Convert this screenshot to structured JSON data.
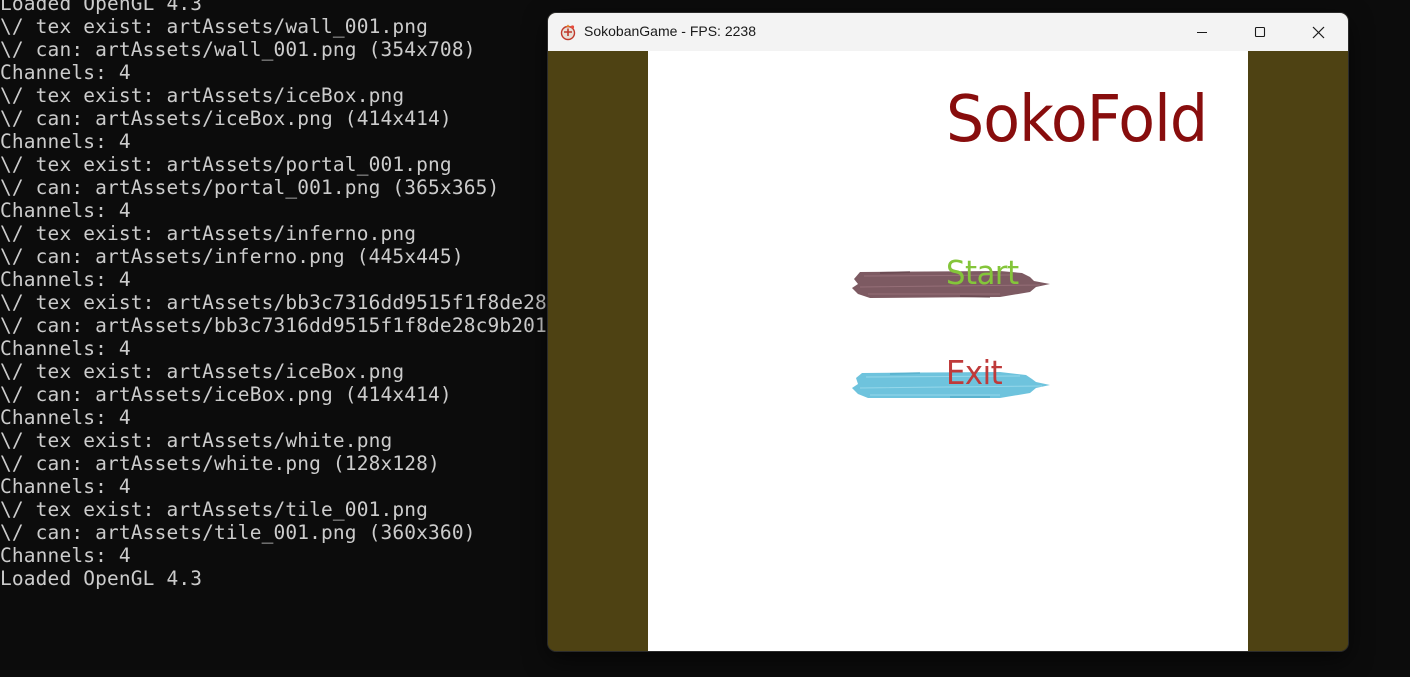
{
  "console": {
    "lines": [
      "Loaded OpenGL 4.3",
      "\\/ tex exist: artAssets/wall_001.png",
      "\\/ can: artAssets/wall_001.png (354x708)",
      "Channels: 4",
      "\\/ tex exist: artAssets/iceBox.png",
      "\\/ can: artAssets/iceBox.png (414x414)",
      "Channels: 4",
      "\\/ tex exist: artAssets/portal_001.png",
      "\\/ can: artAssets/portal_001.png (365x365)",
      "Channels: 4",
      "\\/ tex exist: artAssets/inferno.png",
      "\\/ can: artAssets/inferno.png (445x445)",
      "Channels: 4",
      "\\/ tex exist: artAssets/bb3c7316dd9515f1f8de28",
      "\\/ can: artAssets/bb3c7316dd9515f1f8de28c9b201",
      "Channels: 4",
      "\\/ tex exist: artAssets/iceBox.png",
      "\\/ can: artAssets/iceBox.png (414x414)",
      "Channels: 4",
      "\\/ tex exist: artAssets/white.png",
      "\\/ can: artAssets/white.png (128x128)",
      "Channels: 4",
      "\\/ tex exist: artAssets/tile_001.png",
      "\\/ can: artAssets/tile_001.png (360x360)",
      "Channels: 4",
      "Loaded OpenGL 4.3"
    ],
    "colors": {
      "background": "#0c0c0c",
      "text": "#cccccc"
    }
  },
  "window": {
    "title": "SokobanGame - FPS: 2238",
    "app_icon": "game-controller-icon",
    "controls": {
      "minimize_icon": "minimize-icon",
      "maximize_icon": "maximize-icon",
      "close_icon": "close-icon"
    },
    "colors": {
      "titlebar": "#f3f3f3",
      "border_fill": "#4e4213",
      "canvas": "#ffffff"
    }
  },
  "game": {
    "title": "SokoFold",
    "title_color": "#880d0d",
    "menu": [
      {
        "id": "start",
        "label": "Start",
        "label_color": "#84c53a",
        "brush_color": "#7d5a62",
        "brush_icon": "brush-stroke-icon"
      },
      {
        "id": "exit",
        "label": "Exit",
        "label_color": "#bf3a3a",
        "brush_color": "#6ec3dd",
        "brush_icon": "brush-stroke-icon"
      }
    ]
  }
}
